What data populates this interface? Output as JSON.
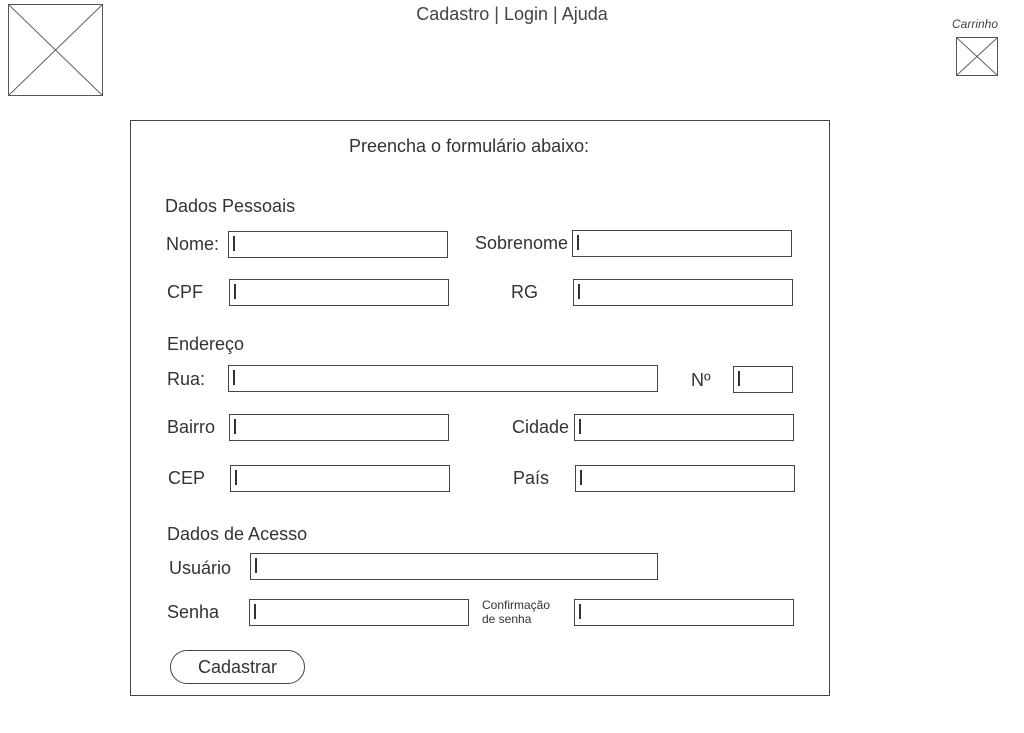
{
  "nav": {
    "items": [
      "Cadastro",
      "Login",
      "Ajuda"
    ],
    "separator": "|"
  },
  "cart": {
    "label": "Carrinho"
  },
  "form": {
    "title": "Preencha o formulário abaixo:",
    "section_personal": "Dados Pessoais",
    "section_address": "Endereço",
    "section_access": "Dados de Acesso",
    "labels": {
      "nome": "Nome:",
      "sobrenome": "Sobrenome",
      "cpf": "CPF",
      "rg": "RG",
      "rua": "Rua:",
      "numero": "Nº",
      "bairro": "Bairro",
      "cidade": "Cidade",
      "cep": "CEP",
      "pais": "País",
      "usuario": "Usuário",
      "senha": "Senha",
      "confirmacao": "Confirmação de senha"
    },
    "submit_label": "Cadastrar"
  }
}
